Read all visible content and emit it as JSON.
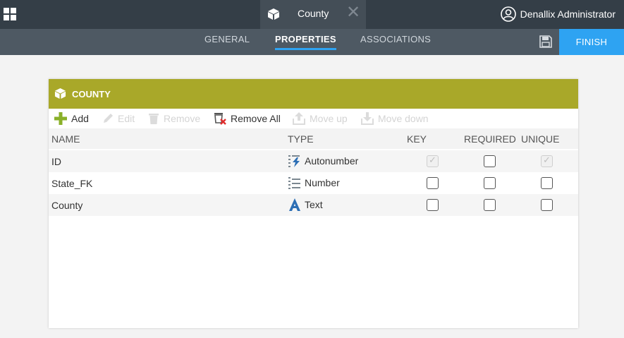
{
  "topbar": {
    "apps_icon": "apps-grid-icon",
    "document_tab": {
      "icon": "cube-icon",
      "title": "County",
      "close_icon": "close-icon"
    },
    "user": {
      "icon": "user-avatar-icon",
      "name": "Denallix Administrator"
    }
  },
  "subnav": {
    "tabs": [
      {
        "label": "GENERAL",
        "active": false
      },
      {
        "label": "PROPERTIES",
        "active": true
      },
      {
        "label": "ASSOCIATIONS",
        "active": false
      }
    ],
    "save_icon": "save-icon",
    "finish_label": "FINISH"
  },
  "panel": {
    "icon": "cube-icon",
    "title": "COUNTY",
    "toolbar": {
      "add": "Add",
      "edit": "Edit",
      "remove": "Remove",
      "remove_all": "Remove All",
      "move_up": "Move up",
      "move_down": "Move down"
    },
    "columns": {
      "name": "NAME",
      "type": "TYPE",
      "key": "KEY",
      "required": "REQUIRED",
      "unique": "UNIQUE"
    },
    "rows": [
      {
        "name": "ID",
        "type": "Autonumber",
        "type_icon": "autonumber-icon",
        "key": "checked-disabled",
        "required": "unchecked",
        "unique": "checked-disabled"
      },
      {
        "name": "State_FK",
        "type": "Number",
        "type_icon": "number-icon",
        "key": "unchecked",
        "required": "unchecked",
        "unique": "unchecked"
      },
      {
        "name": "County",
        "type": "Text",
        "type_icon": "text-icon",
        "key": "unchecked",
        "required": "unchecked",
        "unique": "unchecked"
      }
    ]
  },
  "colors": {
    "topbar": "#343e47",
    "subbar": "#4e5963",
    "accent_blue": "#2ea3f2",
    "panel_header": "#a9a829",
    "add_green": "#8ab029"
  }
}
